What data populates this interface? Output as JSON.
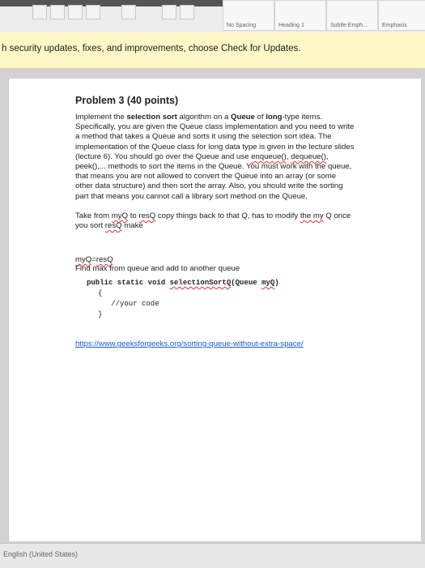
{
  "ribbon": {
    "styles": [
      "No Spacing",
      "Heading 1",
      "Subtle Emph...",
      "Emphasis"
    ]
  },
  "infobar": {
    "text": "h security updates, fixes, and improvements, choose Check for Updates."
  },
  "document": {
    "title": "Problem 3 (40 points)",
    "para1_a": "Implement the ",
    "para1_b": "selection sort",
    "para1_c": " algorithm on a ",
    "para1_d": "Queue",
    "para1_e": " of ",
    "para1_f": "long",
    "para1_g": "-type items. Specifically, you are given the Queue class implementation and you need to write a method that takes a Queue and sorts it using the selection sort idea. The implementation of the Queue class for long data type is given in the lecture slides (lecture 6). You should go over the Queue and use ",
    "para1_h": "enqueue()",
    "para1_i": ", ",
    "para1_j": "dequeue()",
    "para1_k": ", peek(),... methods to sort the items in the Queue. You must work with the queue, that means you are not allowed to convert the Queue into an array (or some other data structure) and then sort the array. Also, you should write the sorting part that means you cannot call a library sort method on the Queue.",
    "para2_a": "Take from ",
    "para2_b": "myQ",
    "para2_c": " to ",
    "para2_d": "resQ",
    "para2_e": " copy things back to that Q, has to modify ",
    "para2_f": "the my",
    "para2_g": " Q once you sort ",
    "para2_h": "resQ",
    "para2_i": " make",
    "code_head_a": "myQ",
    "code_head_b": "=",
    "code_head_c": "resQ",
    "code_head_line2": "Find max from queue and add to another queue",
    "code_sig_a": "public static void ",
    "code_sig_b": "selectionSortQ",
    "code_sig_c": "(Queue ",
    "code_sig_d": "myQ",
    "code_sig_e": ")",
    "code_open": "{",
    "code_body": "   //your code",
    "code_close": "}",
    "link": "https://www.geeksforgeeks.org/sorting-queue-without-extra-space/"
  },
  "status": {
    "language": "English (United States)"
  }
}
